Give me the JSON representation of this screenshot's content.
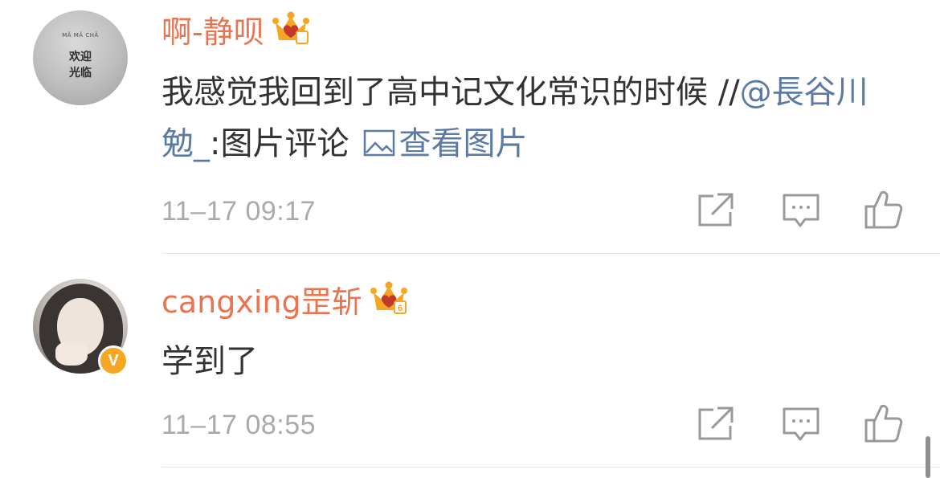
{
  "comments": [
    {
      "avatar": {
        "tiny_text": "MĂ MĂ CHĂ",
        "welcome_line1": "欢迎",
        "welcome_line2": "光临"
      },
      "username": "啊-静呗",
      "badge": "crown-icon",
      "text_main": "我感觉我回到了高中记文化常识的时候 //",
      "mention": "@長谷川勉_",
      "text_after_mention": ":图片评论",
      "view_image_label": "查看图片",
      "timestamp": "11–17 09:17"
    },
    {
      "username": "cangxing罡斩",
      "badge": "crown-level-6-icon",
      "badge_level": "6",
      "verified_label": "V",
      "text": "学到了",
      "timestamp": "11–17 08:55"
    }
  ],
  "colors": {
    "username": "#eb7350",
    "link": "#5b7ba6",
    "timestamp": "#aaaaaa",
    "crown": "#f5a623",
    "verified": "#f5a623",
    "text": "#333333"
  },
  "icons": [
    "share-icon",
    "comment-icon",
    "like-icon",
    "image-icon",
    "crown-icon"
  ]
}
